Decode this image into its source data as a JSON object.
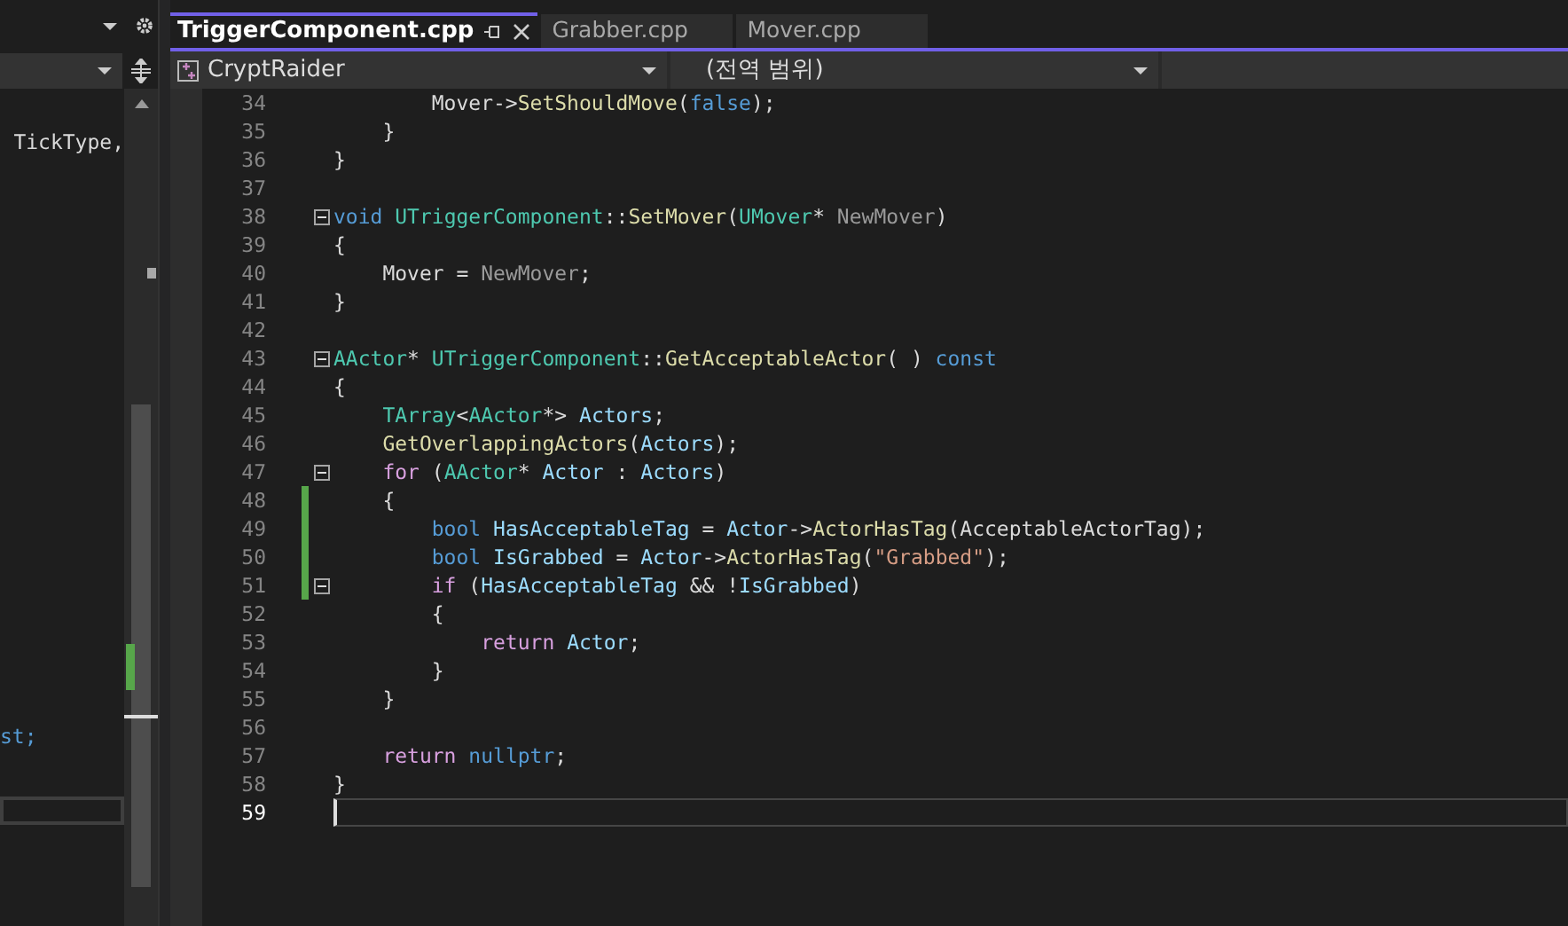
{
  "left_pane": {
    "lines": [
      {
        "text": "TickType,",
        "kind": "plain"
      },
      {
        "text": "st;",
        "kind": "keyword"
      }
    ]
  },
  "tabs": [
    {
      "label": "TriggerComponent.cpp",
      "selected": true
    },
    {
      "label": "Grabber.cpp",
      "selected": false
    },
    {
      "label": "Mover.cpp",
      "selected": false
    }
  ],
  "nav_bar": {
    "project": "CryptRaider",
    "scope": "(전역 범위)"
  },
  "editor": {
    "lines": [
      {
        "number": "34",
        "current": false,
        "tokens": [
          {
            "text": "        Mover->",
            "kind": "plain"
          },
          {
            "text": "SetShouldMove",
            "kind": "func"
          },
          {
            "text": "(",
            "kind": "plain"
          },
          {
            "text": "false",
            "kind": "keyword"
          },
          {
            "text": ");",
            "kind": "plain"
          }
        ]
      },
      {
        "number": "35",
        "current": false,
        "tokens": [
          {
            "text": "    }",
            "kind": "plain"
          }
        ]
      },
      {
        "number": "36",
        "current": false,
        "tokens": [
          {
            "text": "}",
            "kind": "plain"
          }
        ]
      },
      {
        "number": "37",
        "current": false
      },
      {
        "number": "38",
        "fold": true,
        "current": false,
        "tokens": [
          {
            "text": "void ",
            "kind": "keyword"
          },
          {
            "text": "UTriggerComponent",
            "kind": "type"
          },
          {
            "text": "::",
            "kind": "plain"
          },
          {
            "text": "SetMover",
            "kind": "func"
          },
          {
            "text": "(",
            "kind": "plain"
          },
          {
            "text": "UMover",
            "kind": "type"
          },
          {
            "text": "* ",
            "kind": "plain"
          },
          {
            "text": "NewMover",
            "kind": "param"
          },
          {
            "text": ")",
            "kind": "plain"
          }
        ]
      },
      {
        "number": "39",
        "current": false,
        "tokens": [
          {
            "text": "{",
            "kind": "plain"
          }
        ]
      },
      {
        "number": "40",
        "current": false,
        "tokens": [
          {
            "text": "    Mover = ",
            "kind": "plain"
          },
          {
            "text": "NewMover",
            "kind": "param"
          },
          {
            "text": ";",
            "kind": "plain"
          }
        ]
      },
      {
        "number": "41",
        "current": false,
        "tokens": [
          {
            "text": "}",
            "kind": "plain"
          }
        ]
      },
      {
        "number": "42",
        "current": false
      },
      {
        "number": "43",
        "fold": true,
        "current": false,
        "tokens": [
          {
            "text": "AActor",
            "kind": "type"
          },
          {
            "text": "* ",
            "kind": "plain"
          },
          {
            "text": "UTriggerComponent",
            "kind": "type"
          },
          {
            "text": "::",
            "kind": "plain"
          },
          {
            "text": "GetAcceptableActor",
            "kind": "func"
          },
          {
            "text": "( ) ",
            "kind": "plain"
          },
          {
            "text": "const",
            "kind": "keyword"
          }
        ]
      },
      {
        "number": "44",
        "current": false,
        "tokens": [
          {
            "text": "{",
            "kind": "plain"
          }
        ]
      },
      {
        "number": "45",
        "current": false,
        "tokens": [
          {
            "text": "    TArray",
            "kind": "type"
          },
          {
            "text": "<",
            "kind": "plain"
          },
          {
            "text": "AActor",
            "kind": "type"
          },
          {
            "text": "*> ",
            "kind": "plain"
          },
          {
            "text": "Actors",
            "kind": "var"
          },
          {
            "text": ";",
            "kind": "plain"
          }
        ]
      },
      {
        "number": "46",
        "current": false,
        "tokens": [
          {
            "text": "    GetOverlappingActors",
            "kind": "func"
          },
          {
            "text": "(",
            "kind": "plain"
          },
          {
            "text": "Actors",
            "kind": "var"
          },
          {
            "text": ");",
            "kind": "plain"
          }
        ]
      },
      {
        "number": "47",
        "fold": true,
        "current": false,
        "tokens": [
          {
            "text": "    for",
            "kind": "control"
          },
          {
            "text": " (",
            "kind": "plain"
          },
          {
            "text": "AActor",
            "kind": "type"
          },
          {
            "text": "* ",
            "kind": "plain"
          },
          {
            "text": "Actor",
            "kind": "var"
          },
          {
            "text": " : ",
            "kind": "plain"
          },
          {
            "text": "Actors",
            "kind": "var"
          },
          {
            "text": ")",
            "kind": "plain"
          }
        ]
      },
      {
        "number": "48",
        "changed": true,
        "current": false,
        "tokens": [
          {
            "text": "    {",
            "kind": "plain"
          }
        ]
      },
      {
        "number": "49",
        "changed": true,
        "current": false,
        "tokens": [
          {
            "text": "        bool ",
            "kind": "keyword"
          },
          {
            "text": "HasAcceptableTag",
            "kind": "var"
          },
          {
            "text": " = ",
            "kind": "plain"
          },
          {
            "text": "Actor",
            "kind": "var"
          },
          {
            "text": "->",
            "kind": "plain"
          },
          {
            "text": "ActorHasTag",
            "kind": "func"
          },
          {
            "text": "(AcceptableActorTag);",
            "kind": "plain"
          }
        ]
      },
      {
        "number": "50",
        "changed": true,
        "current": false,
        "tokens": [
          {
            "text": "        bool ",
            "kind": "keyword"
          },
          {
            "text": "IsGrabbed",
            "kind": "var"
          },
          {
            "text": " = ",
            "kind": "plain"
          },
          {
            "text": "Actor",
            "kind": "var"
          },
          {
            "text": "->",
            "kind": "plain"
          },
          {
            "text": "ActorHasTag",
            "kind": "func"
          },
          {
            "text": "(",
            "kind": "plain"
          },
          {
            "text": "\"Grabbed\"",
            "kind": "string"
          },
          {
            "text": ");",
            "kind": "plain"
          }
        ]
      },
      {
        "number": "51",
        "fold": true,
        "changed": true,
        "current": false,
        "tokens": [
          {
            "text": "        if",
            "kind": "control"
          },
          {
            "text": " (",
            "kind": "plain"
          },
          {
            "text": "HasAcceptableTag",
            "kind": "var"
          },
          {
            "text": " && !",
            "kind": "plain"
          },
          {
            "text": "IsGrabbed",
            "kind": "var"
          },
          {
            "text": ")",
            "kind": "plain"
          }
        ]
      },
      {
        "number": "52",
        "current": false,
        "tokens": [
          {
            "text": "        {",
            "kind": "plain"
          }
        ]
      },
      {
        "number": "53",
        "current": false,
        "tokens": [
          {
            "text": "            return ",
            "kind": "control"
          },
          {
            "text": "Actor",
            "kind": "var"
          },
          {
            "text": ";",
            "kind": "plain"
          }
        ]
      },
      {
        "number": "54",
        "current": false,
        "tokens": [
          {
            "text": "        }",
            "kind": "plain"
          }
        ]
      },
      {
        "number": "55",
        "current": false,
        "tokens": [
          {
            "text": "    }",
            "kind": "plain"
          }
        ]
      },
      {
        "number": "56",
        "current": false
      },
      {
        "number": "57",
        "current": false,
        "tokens": [
          {
            "text": "    return ",
            "kind": "control"
          },
          {
            "text": "nullptr",
            "kind": "keyword"
          },
          {
            "text": ";",
            "kind": "plain"
          }
        ]
      },
      {
        "number": "58",
        "current": false,
        "tokens": [
          {
            "text": "}",
            "kind": "plain"
          }
        ]
      },
      {
        "number": "59",
        "current": true
      }
    ]
  }
}
